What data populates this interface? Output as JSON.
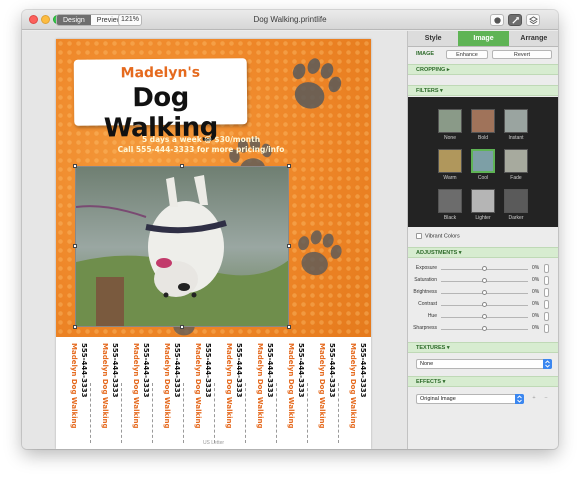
{
  "window": {
    "title": "Dog Walking.printlife",
    "mode_tabs": [
      "Design",
      "Preview"
    ],
    "active_mode": "Design",
    "zoom": "121%"
  },
  "flyer": {
    "name": "Madelyn's",
    "business": "Dog Walking",
    "tagline_1": "5 days a week @ $30/month",
    "tagline_2": "Call 555-444-3333 for more pricing/info",
    "tab_business": "Madelyn Dog Walking",
    "tab_phone": "555-444-3333",
    "tab_count": 10,
    "paper_size": "US Letter"
  },
  "inspector": {
    "tabs": [
      "Style",
      "Image",
      "Arrange"
    ],
    "active_tab": "Image",
    "image_label": "IMAGE",
    "enhance_label": "Enhance",
    "revert_label": "Revert",
    "cropping_label": "CROPPING ▸",
    "filters_label": "FILTERS ▾",
    "filters": [
      {
        "label": "None",
        "tone": "#8a9a88"
      },
      {
        "label": "Bold",
        "tone": "#a0735a"
      },
      {
        "label": "Instant",
        "tone": "#9aa4a0"
      },
      {
        "label": "Warm",
        "tone": "#b0975c"
      },
      {
        "label": "Cool",
        "tone": "#7d9fa6"
      },
      {
        "label": "Fade",
        "tone": "#a7aa9e"
      },
      {
        "label": "Black",
        "tone": "#6c6c6c"
      },
      {
        "label": "Lighter",
        "tone": "#b5b5b5"
      },
      {
        "label": "Darker",
        "tone": "#5a5a5a"
      }
    ],
    "selected_filter": "Cool",
    "vibrant_label": "Vibrant Colors",
    "adjustments_label": "ADJUSTMENTS ▾",
    "adjustments": [
      {
        "label": "Exposure",
        "value": "0%",
        "level": 0.5
      },
      {
        "label": "Saturation",
        "value": "0%",
        "level": 0.5
      },
      {
        "label": "Brightness",
        "value": "0%",
        "level": 0.5
      },
      {
        "label": "Contrast",
        "value": "0%",
        "level": 0.5
      },
      {
        "label": "Hue",
        "value": "0%",
        "level": 0.5
      },
      {
        "label": "Sharpness",
        "value": "0%",
        "level": 0.5
      }
    ],
    "textures_label": "TEXTURES ▾",
    "texture_value": "None",
    "effects_label": "EFFECTS ▾",
    "effect_value": "Original Image",
    "add_label": "+",
    "remove_label": "−"
  },
  "colors": {
    "accent": "#5fb455",
    "flyer_orange": "#ee8628",
    "tab_orange": "#e56a1e",
    "popup_blue": "#3b87f0"
  }
}
